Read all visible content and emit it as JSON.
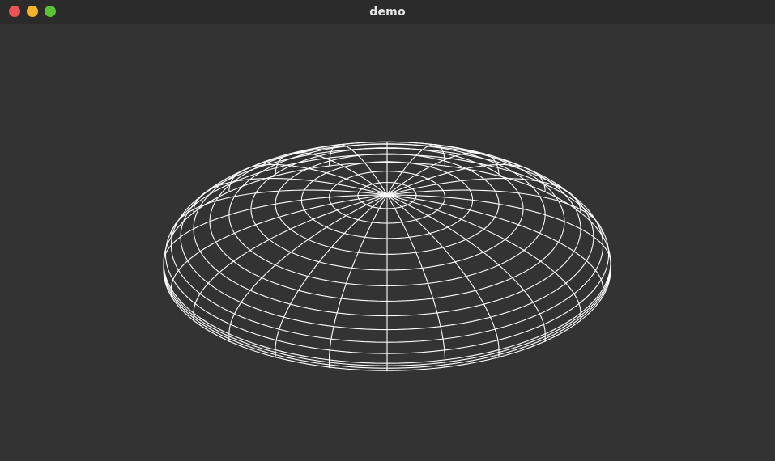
{
  "window": {
    "title": "demo",
    "buttons": [
      {
        "name": "close",
        "color": "#e95454"
      },
      {
        "name": "minimize",
        "color": "#f4b429"
      },
      {
        "name": "maximize",
        "color": "#5bc236"
      }
    ]
  },
  "viewport": {
    "background": "#333333",
    "wireframe_color": "#ffffff",
    "shape": "oblate-spheroid-wireframe",
    "meridians": 24,
    "parallels": 12
  }
}
